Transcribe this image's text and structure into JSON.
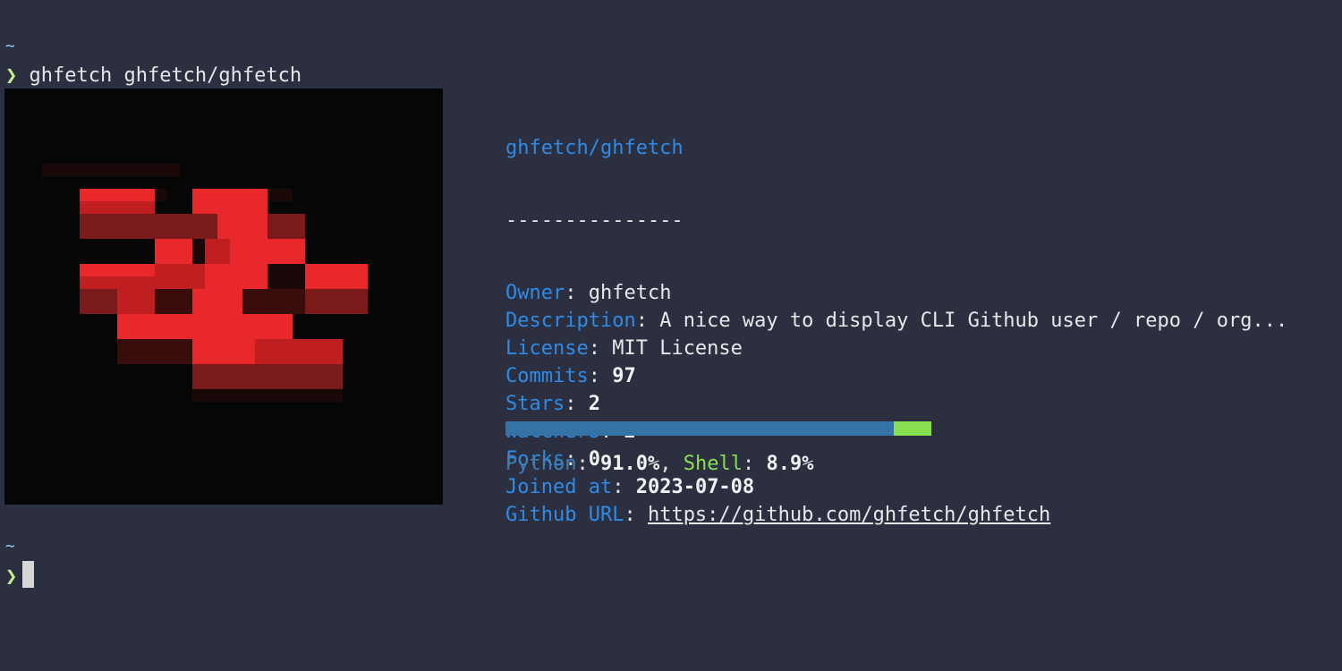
{
  "terminal": {
    "cwd_symbol": "~",
    "prompt_symbol": "❯",
    "command": "ghfetch ghfetch/ghfetch"
  },
  "avatar": {
    "description": "pixelated red identicon",
    "background": "#060606"
  },
  "repo": {
    "title": "ghfetch/ghfetch",
    "divider": "---------------",
    "fields": [
      {
        "key": "Owner",
        "value": "ghfetch",
        "bold": false
      },
      {
        "key": "Description",
        "value": "A nice way to display CLI Github user / repo / org...",
        "bold": false
      },
      {
        "key": "License",
        "value": "MIT License",
        "bold": false
      },
      {
        "key": "Commits",
        "value": "97",
        "bold": true
      },
      {
        "key": "Stars",
        "value": "2",
        "bold": true
      },
      {
        "key": "Watchers",
        "value": "2",
        "bold": true
      },
      {
        "key": "Forks",
        "value": "0",
        "bold": true
      },
      {
        "key": "Joined at",
        "value": "2023-07-08",
        "bold": true
      },
      {
        "key": "Github URL",
        "value": "https://github.com/ghfetch/ghfetch",
        "bold": false,
        "link": true
      }
    ]
  },
  "languages": [
    {
      "name": "Python",
      "percent": "91.0%",
      "share": 0.911,
      "color": "#3572a5"
    },
    {
      "name": "Shell",
      "percent": "8.9%",
      "share": 0.089,
      "color": "#89e051"
    }
  ],
  "colors": {
    "background": "#2b2f3f",
    "key": "#2f8be6",
    "prompt": "#c6f08a"
  }
}
